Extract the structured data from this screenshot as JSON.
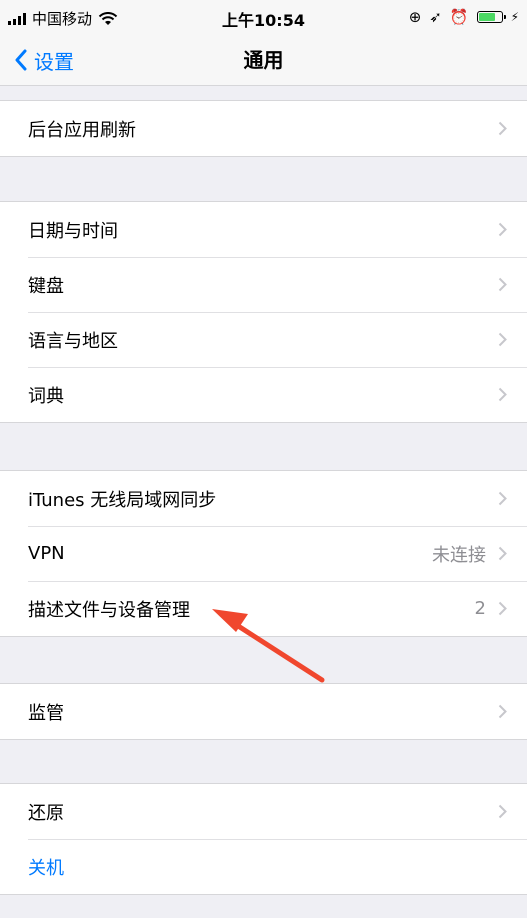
{
  "status_bar": {
    "carrier": "中国移动",
    "time": "上午10:54",
    "battery_level": 0.7,
    "accent_green": "#4cd964",
    "icons": [
      "signal-icon",
      "wifi-icon",
      "orientation-lock-icon",
      "location-icon",
      "alarm-icon",
      "battery-icon",
      "charging-icon"
    ]
  },
  "nav": {
    "back_label": "设置",
    "title": "通用",
    "accent": "#007aff"
  },
  "groups": [
    {
      "items": [
        {
          "label": "后台应用刷新",
          "value": ""
        }
      ]
    },
    {
      "items": [
        {
          "label": "日期与时间",
          "value": ""
        },
        {
          "label": "键盘",
          "value": ""
        },
        {
          "label": "语言与地区",
          "value": ""
        },
        {
          "label": "词典",
          "value": ""
        }
      ]
    },
    {
      "items": [
        {
          "label": "iTunes 无线局域网同步",
          "value": ""
        },
        {
          "label": "VPN",
          "value": "未连接"
        },
        {
          "label": "描述文件与设备管理",
          "value": "2"
        }
      ]
    },
    {
      "items": [
        {
          "label": "监管",
          "value": ""
        }
      ]
    },
    {
      "items": [
        {
          "label": "还原",
          "value": ""
        },
        {
          "label": "关机",
          "value": ""
        }
      ]
    }
  ],
  "annotation": {
    "arrow_color": "#f0472e"
  }
}
